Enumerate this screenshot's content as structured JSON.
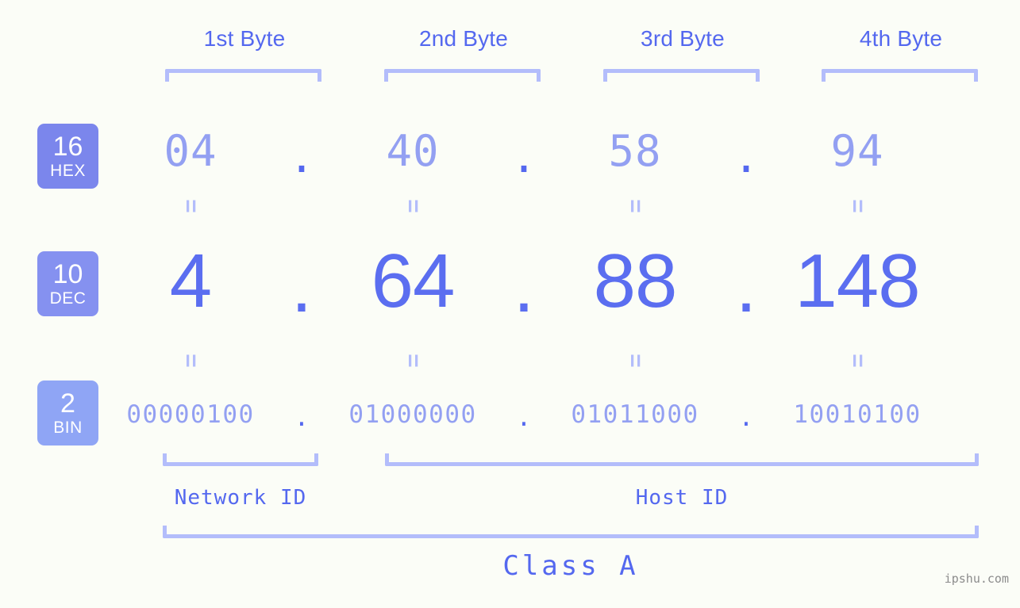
{
  "meta": {
    "background_color": "#fbfdf7",
    "accent_color": "#5b6ef0",
    "muted_color": "#93a0f2",
    "bracket_color": "#b3bdfb",
    "watermark": "ipshu.com"
  },
  "byte_headers": [
    {
      "label": "1st Byte"
    },
    {
      "label": "2nd Byte"
    },
    {
      "label": "3rd Byte"
    },
    {
      "label": "4th Byte"
    }
  ],
  "bases": [
    {
      "number": "16",
      "name": "HEX",
      "color": "#7b86ec"
    },
    {
      "number": "10",
      "name": "DEC",
      "color": "#8591f0"
    },
    {
      "number": "2",
      "name": "BIN",
      "color": "#8fa5f5"
    }
  ],
  "rows": {
    "hex": {
      "base_number": "16",
      "base_name": "HEX",
      "values": [
        "04",
        "40",
        "58",
        "94"
      ],
      "separator": "."
    },
    "dec": {
      "base_number": "10",
      "base_name": "DEC",
      "values": [
        "4",
        "64",
        "88",
        "148"
      ],
      "separator": "."
    },
    "bin": {
      "base_number": "2",
      "base_name": "BIN",
      "values": [
        "00000100",
        "01000000",
        "01011000",
        "10010100"
      ],
      "separator": "."
    }
  },
  "equals_marker": "=",
  "sections": {
    "network_id": "Network ID",
    "host_id": "Host ID",
    "class": "Class A"
  }
}
